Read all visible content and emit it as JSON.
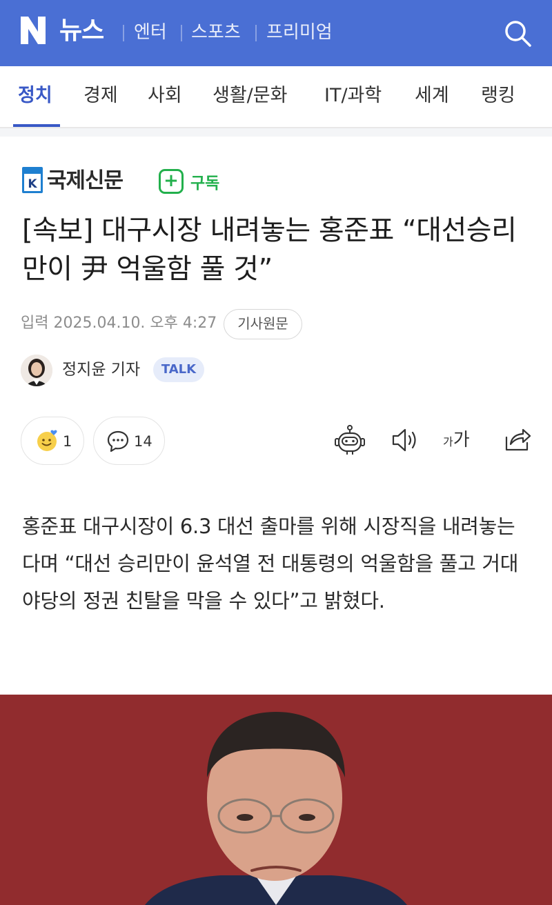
{
  "header": {
    "brand_letter": "N",
    "title": "뉴스",
    "links": [
      "엔터",
      "스포츠",
      "프리미엄"
    ],
    "colors": {
      "bar": "#4a6fd4"
    }
  },
  "categories": {
    "items": [
      "정치",
      "경제",
      "사회",
      "생활/문화",
      "IT/과학",
      "세계",
      "랭킹"
    ],
    "active": "정치"
  },
  "press": {
    "logo_letter": "K",
    "name": "국제신문",
    "subscribe_label": "구독",
    "subscribe_plus": "+"
  },
  "article": {
    "headline": "[속보] 대구시장 내려놓는 홍준표 “대선승리만이 尹 억울함 풀 것”",
    "date_text": "입력 2025.04.10. 오후 4:27",
    "original_link_label": "기사원문",
    "reporter": "정지윤 기자",
    "talk_label": "TALK",
    "body": "홍준표 대구시장이 6.3 대선 출마를 위해 시장직을 내려놓는다며 “대선 승리만이 윤석열 전 대통령의 억울함을 풀고 거대 야당의 정권 친탈을 막을 수 있다”고 밝혔다."
  },
  "actions": {
    "reaction_count": "1",
    "comment_count": "14",
    "font_size_label": "가가",
    "icons": [
      "smiley-reaction-icon",
      "comment-icon",
      "robot-summary-icon",
      "speaker-icon",
      "font-size-icon",
      "share-icon"
    ]
  }
}
